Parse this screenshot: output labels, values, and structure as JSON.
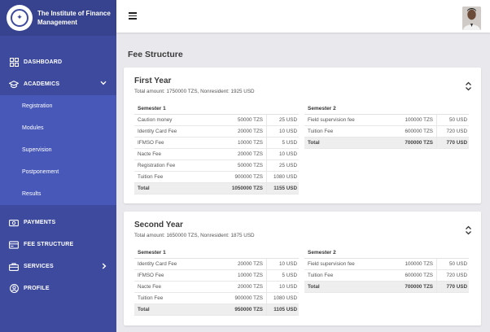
{
  "brand": {
    "name": "The Institute of Finance Management",
    "logo_icon": "emblem-icon"
  },
  "nav": {
    "dashboard": "DASHBOARD",
    "academics": "ACADEMICS",
    "academics_sub": [
      "Registration",
      "Modules",
      "Supervision",
      "Postponement",
      "Results"
    ],
    "payments": "PAYMENTS",
    "fee_structure": "FEE STRUCTURE",
    "services": "SERVICES",
    "profile": "PROFILE"
  },
  "page": {
    "title": "Fee Structure"
  },
  "colors": {
    "sidebar": "#3d4a9e",
    "submenu": "#4758b8",
    "background": "#e9e9ed"
  },
  "years": [
    {
      "title": "First Year",
      "summary": "Total amount: 1750000 TZS, Nonresident: 1925 USD",
      "semesters": [
        {
          "title": "Semester 1",
          "rows": [
            [
              "Caution money",
              "50000 TZS",
              "25 USD"
            ],
            [
              "Identity Card Fee",
              "20000 TZS",
              "10 USD"
            ],
            [
              "IFMSO Fee",
              "10000 TZS",
              "5 USD"
            ],
            [
              "Nacte Fee",
              "20000 TZS",
              "10 USD"
            ],
            [
              "Registration Fee",
              "50000 TZS",
              "25 USD"
            ],
            [
              "Tuition Fee",
              "900000 TZS",
              "1080 USD"
            ]
          ],
          "total": [
            "Total",
            "1050000 TZS",
            "1155 USD"
          ]
        },
        {
          "title": "Semester 2",
          "rows": [
            [
              "Field supervision fee",
              "100000 TZS",
              "50 USD"
            ],
            [
              "Tuition Fee",
              "600000 TZS",
              "720 USD"
            ]
          ],
          "total": [
            "Total",
            "700000 TZS",
            "770 USD"
          ]
        }
      ]
    },
    {
      "title": "Second Year",
      "summary": "Total amount: 1650000 TZS, Nonresident: 1875 USD",
      "semesters": [
        {
          "title": "Semester 1",
          "rows": [
            [
              "Identity Card Fee",
              "20000 TZS",
              "10 USD"
            ],
            [
              "IFMSO Fee",
              "10000 TZS",
              "5 USD"
            ],
            [
              "Nacte Fee",
              "20000 TZS",
              "10 USD"
            ],
            [
              "Tuition Fee",
              "900000 TZS",
              "1080 USD"
            ]
          ],
          "total": [
            "Total",
            "950000 TZS",
            "1105 USD"
          ]
        },
        {
          "title": "Semester 2",
          "rows": [
            [
              "Field supervision fee",
              "100000 TZS",
              "50 USD"
            ],
            [
              "Tuition Fee",
              "600000 TZS",
              "720 USD"
            ]
          ],
          "total": [
            "Total",
            "700000 TZS",
            "770 USD"
          ]
        }
      ]
    }
  ]
}
